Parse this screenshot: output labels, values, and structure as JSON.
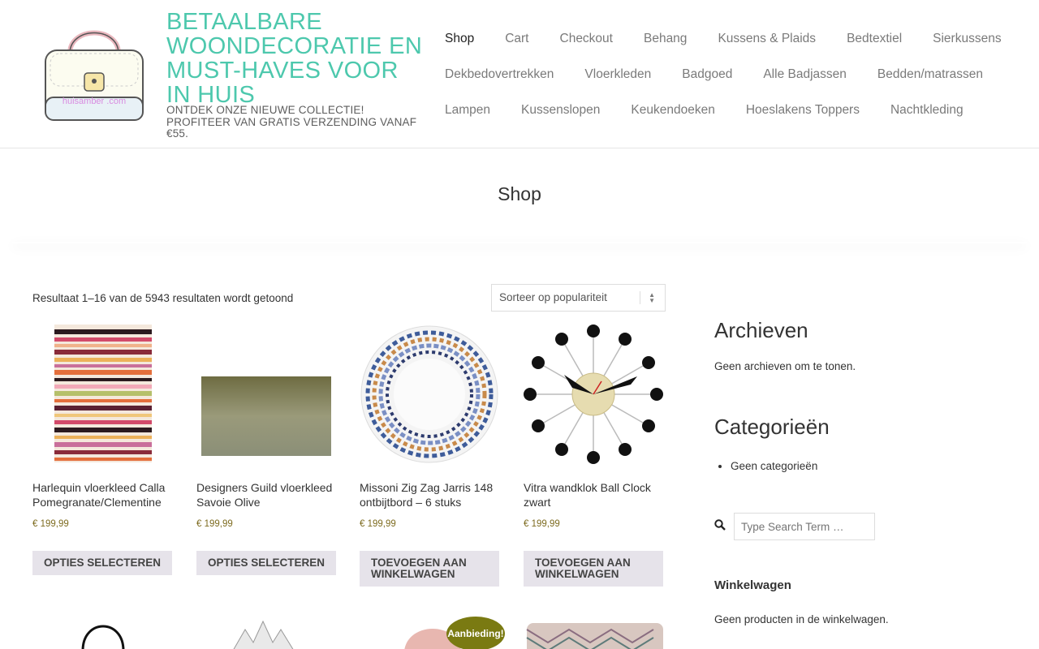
{
  "site": {
    "logo_text": "huisamber .com",
    "title": "BETAALBARE WOONDECORATIE EN MUST-HAVES VOOR IN HUIS",
    "description": "ONTDEK ONZE NIEUWE COLLECTIE! PROFITEER VAN GRATIS VERZENDING VANAF €55."
  },
  "nav": {
    "row1": [
      "Shop",
      "Cart",
      "Checkout",
      "Behang",
      "Kussens & Plaids",
      "Bedtextiel",
      "Sierkussens"
    ],
    "row2": [
      "Dekbedovertrekken",
      "Vloerkleden",
      "Badgoed",
      "Alle Badjassen",
      "Bedden/matrassen"
    ],
    "row3": [
      "Lampen",
      "Kussenslopen",
      "Keukendoeken",
      "Hoeslakens Toppers",
      "Nachtkleding"
    ],
    "active": "Shop"
  },
  "page": {
    "title": "Shop"
  },
  "shop": {
    "result_count": "Resultaat 1–16 van de 5943 resultaten wordt getoond",
    "sort_label": "Sorteer op populariteit",
    "products": [
      {
        "name": "Harlequin vloerkleed Calla Pomegranate/Clementine",
        "price": "€ 199,99",
        "button": "OPTIES SELECTEREN",
        "icon": "striped-rug-image"
      },
      {
        "name": "Designers Guild vloerkleed Savoie Olive",
        "price": "€ 199,99",
        "button": "OPTIES SELECTEREN",
        "icon": "olive-rug-image"
      },
      {
        "name": "Missoni Zig Zag Jarris 148 ontbijtbord – 6 stuks",
        "price": "€ 199,99",
        "button": "TOEVOEGEN AAN WINKELWAGEN",
        "icon": "zigzag-plate-image"
      },
      {
        "name": "Vitra wandklok Ball Clock zwart",
        "price": "€ 199,99",
        "button": "TOEVOEGEN AAN WINKELWAGEN",
        "icon": "ball-clock-image"
      }
    ],
    "sale_badge": "Aanbieding!"
  },
  "sidebar": {
    "archives_title": "Archieven",
    "archives_text": "Geen archieven om te tonen.",
    "categories_title": "Categorieën",
    "categories_item": "Geen categorieën",
    "search_placeholder": "Type Search Term …",
    "cart_title": "Winkelwagen",
    "cart_text": "Geen producten in de winkelwagen."
  },
  "colors": {
    "brand": "#4dc8ad",
    "price": "#7d6b1f",
    "button_bg": "#e6e3ea",
    "badge": "#7a7a12"
  }
}
